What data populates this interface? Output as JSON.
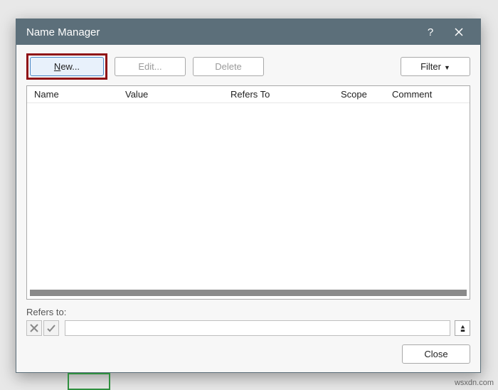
{
  "titlebar": {
    "title": "Name Manager",
    "help": "?",
    "close": "×"
  },
  "toolbar": {
    "new_prefix": "N",
    "new_suffix": "ew...",
    "edit": "Edit...",
    "delete": "Delete",
    "filter": "Filter",
    "filter_caret": "▼"
  },
  "columns": {
    "name": "Name",
    "value": "Value",
    "refers": "Refers To",
    "scope": "Scope",
    "comment": "Comment"
  },
  "refers": {
    "label": "Refers to:",
    "value": ""
  },
  "footer": {
    "close": "Close"
  },
  "watermark": "wsxdn.com"
}
